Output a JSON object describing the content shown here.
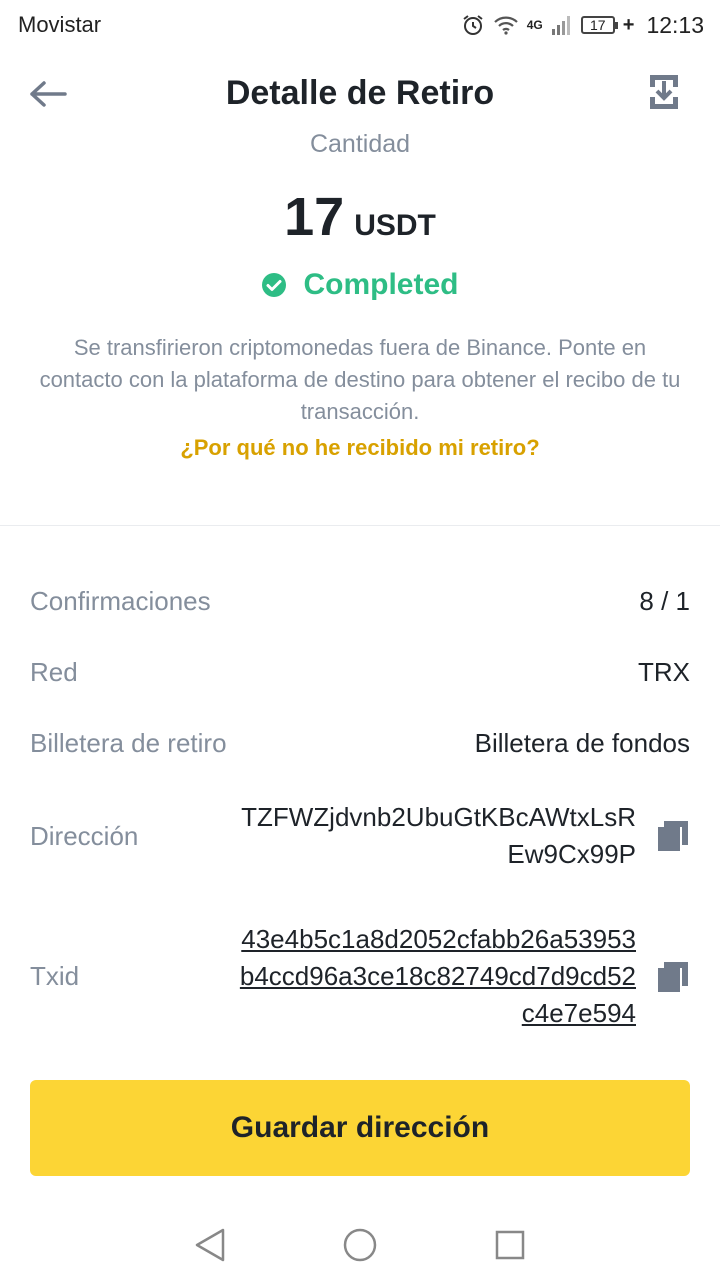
{
  "status_bar": {
    "carrier": "Movistar",
    "network": "4G",
    "battery": "17",
    "time": "12:13"
  },
  "header": {
    "title": "Detalle de Retiro"
  },
  "amount": {
    "label": "Cantidad",
    "value": "17",
    "unit": "USDT"
  },
  "status": {
    "text": "Completed",
    "color": "#2ebd85"
  },
  "info": {
    "message": "Se transfirieron criptomonedas fuera de Binance. Ponte en contacto con la plataforma de destino para obtener el recibo de tu transacción.",
    "link": "¿Por qué no he recibido mi retiro?"
  },
  "details": {
    "confirmations": {
      "label": "Confirmaciones",
      "value": "8 / 1"
    },
    "network": {
      "label": "Red",
      "value": "TRX"
    },
    "wallet": {
      "label": "Billetera de retiro",
      "value": "Billetera de fondos"
    },
    "address": {
      "label": "Dirección",
      "value": "TZFWZjdvnb2UbuGtKBcAWtxLsREw9Cx99P"
    },
    "txid": {
      "label": "Txid",
      "value": "43e4b5c1a8d2052cfabb26a53953b4ccd96a3ce18c82749cd7d9cd52c4e7e594"
    }
  },
  "actions": {
    "save_address": "Guardar dirección"
  },
  "colors": {
    "accent": "#fcd535",
    "link": "#d8a100",
    "muted": "#848e9c",
    "text": "#1e2329"
  }
}
